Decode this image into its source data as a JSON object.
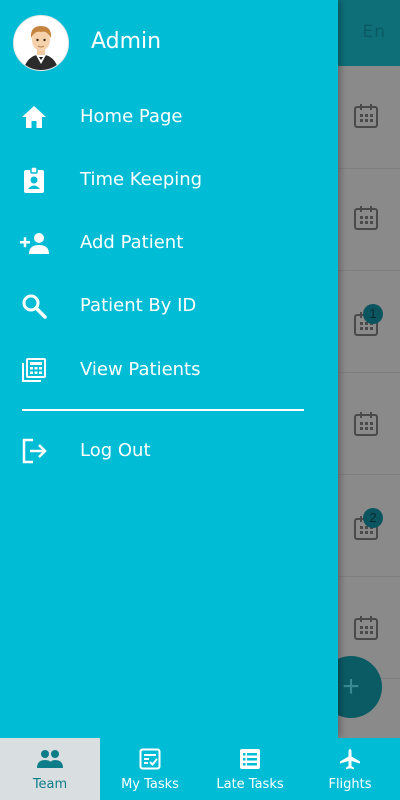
{
  "header": {
    "language_label": "En"
  },
  "drawer": {
    "user_name": "Admin",
    "menu": [
      {
        "label": "Home Page",
        "icon": "home-icon"
      },
      {
        "label": "Time Keeping",
        "icon": "badge-icon"
      },
      {
        "label": "Add Patient",
        "icon": "add-person-icon"
      },
      {
        "label": "Patient By ID",
        "icon": "search-icon"
      },
      {
        "label": "View Patients",
        "icon": "calculator-list-icon"
      }
    ],
    "logout_label": "Log Out"
  },
  "list": {
    "badges": [
      "1",
      "2"
    ]
  },
  "fab": {
    "label": "+"
  },
  "bottom_nav": {
    "tabs": [
      {
        "label": "Team",
        "icon": "team-icon",
        "active": true
      },
      {
        "label": "My Tasks",
        "icon": "task-check-icon",
        "active": false
      },
      {
        "label": "Late Tasks",
        "icon": "task-list-icon",
        "active": false
      },
      {
        "label": "Flights",
        "icon": "airplane-icon",
        "active": false
      }
    ]
  },
  "colors": {
    "primary": "#00bcd4",
    "header_dark": "#0e6f79",
    "overlay_gray": "#8a8a8a",
    "active_tab_bg": "#d9dfe0"
  }
}
